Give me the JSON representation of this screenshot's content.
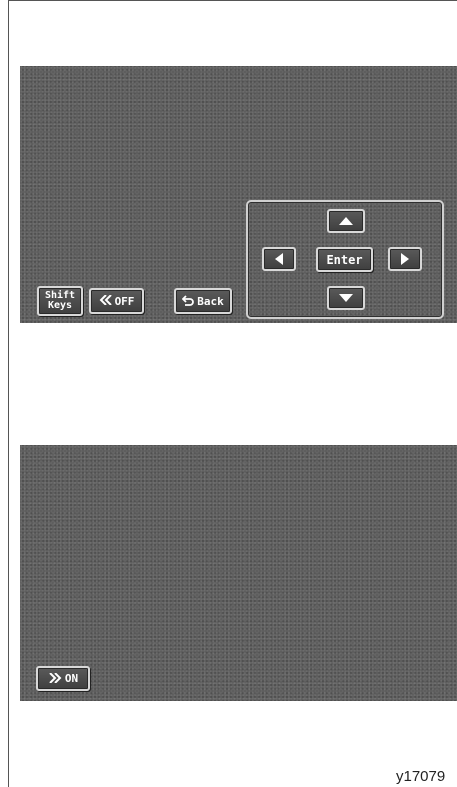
{
  "top_screen": {
    "shift_keys_label": [
      "Shift",
      "Keys"
    ],
    "off_button": {
      "icon": "double-chevron-left-icon",
      "label": "OFF"
    },
    "back_button": {
      "icon": "return-arrow-icon",
      "label": "Back"
    },
    "dpad": {
      "enter_label": "Enter",
      "up_icon": "triangle-up-icon",
      "down_icon": "triangle-down-icon",
      "left_icon": "triangle-left-icon",
      "right_icon": "triangle-right-icon"
    }
  },
  "bottom_screen": {
    "on_button": {
      "icon": "double-chevron-right-icon",
      "label": "ON"
    }
  },
  "figure_code": "y17079",
  "colors": {
    "screen": "#5b5b5b",
    "key_face": "#4a4a4a",
    "key_border": "#d8d8d8",
    "text": "#ffffff"
  }
}
